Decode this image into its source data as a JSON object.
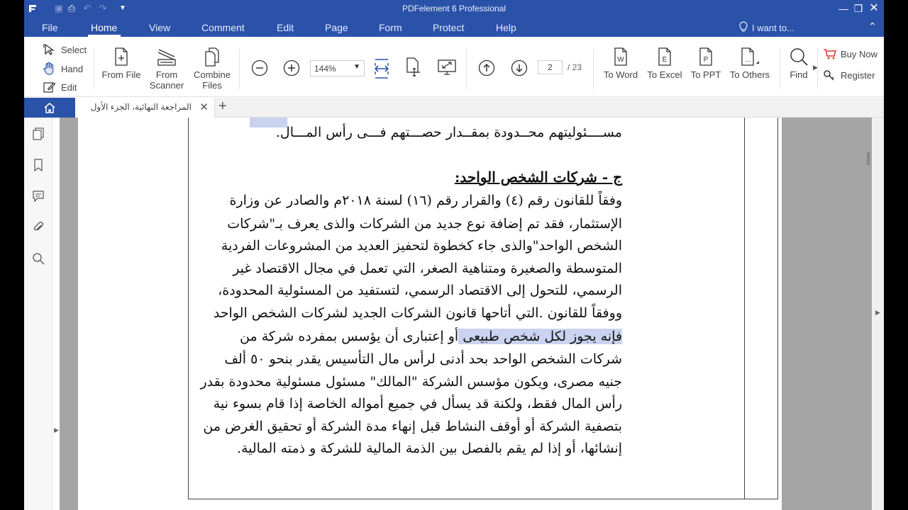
{
  "window": {
    "title": "PDFelement 6 Professional"
  },
  "menu": {
    "items": [
      "File",
      "Home",
      "View",
      "Comment",
      "Edit",
      "Page",
      "Form",
      "Protect",
      "Help"
    ],
    "active": "Home",
    "search_placeholder": "I want to..."
  },
  "ribbon": {
    "select_label": "Select",
    "hand_label": "Hand",
    "edit_label": "Edit",
    "from_file_label": "From File",
    "from_scanner_label": "From\nScanner",
    "combine_files_label": "Combine\nFiles",
    "zoom_value": "144%",
    "current_page": "2",
    "total_pages": "/ 23",
    "to_word_label": "To Word",
    "to_excel_label": "To Excel",
    "to_ppt_label": "To PPT",
    "to_others_label": "To Others",
    "find_label": "Find",
    "buy_now_label": "Buy Now",
    "register_label": "Register"
  },
  "tabs": {
    "document_tab_label": "المراجعة النهائية، الجزء الأول"
  },
  "document": {
    "top_line": "مســــئوليتهم محــدودة بمقــدار حصـــتهم فـــى رأس المـــال.",
    "heading": "ج - شركات الشخص الواحد:",
    "lines": [
      "وفقاً للقانون رقم (٤) والقرار رقم (١٦) لسنة ٢٠١٨م والصادر عن وزارة",
      "الإستثمار، فقد تم إضافة نوع جديد من الشركات والذى يعرف بـ\"شركات",
      "الشخص الواحد\"والذى جاء كخطوة لتحفيز العديد من المشروعات الفردية",
      "المتوسطة والصغيرة ومتناهية الصغر، التي تعمل في مجال الاقتصاد غير",
      "الرسمي، للتحول إلى الاقتصاد الرسمي، لتستفيد من المسئولية المحدودة،",
      "ووفقاً للقانون .التي أتاحها قانون الشركات الجديد لشركات الشخص الواحد",
      "أو إعتبارى أن يؤسس بمفرده شركة من",
      "شركات الشخص الواحد بحد أدنى لرأس مال التأسيس يقدر بنحو ٥٠ ألف",
      "جنيه مصرى، ويكون مؤسس الشركة \"المالك\" مسئول مسئولية محدودة بقدر",
      "رأس المال فقط، ولكنة قد يسأل في جميع أمواله الخاصة إذا قام بسوء نية",
      "بتصفية الشركة أو أوقف النشاط قبل إنهاء مدة الشركة أو تحقيق الغرض من",
      "إنشائها، أو إذا لم يقم بالفصل بين الذمة المالية للشركة و ذمته المالية."
    ],
    "highlighted_text": "فإنه يجوز لكل شخص طبيعى "
  }
}
